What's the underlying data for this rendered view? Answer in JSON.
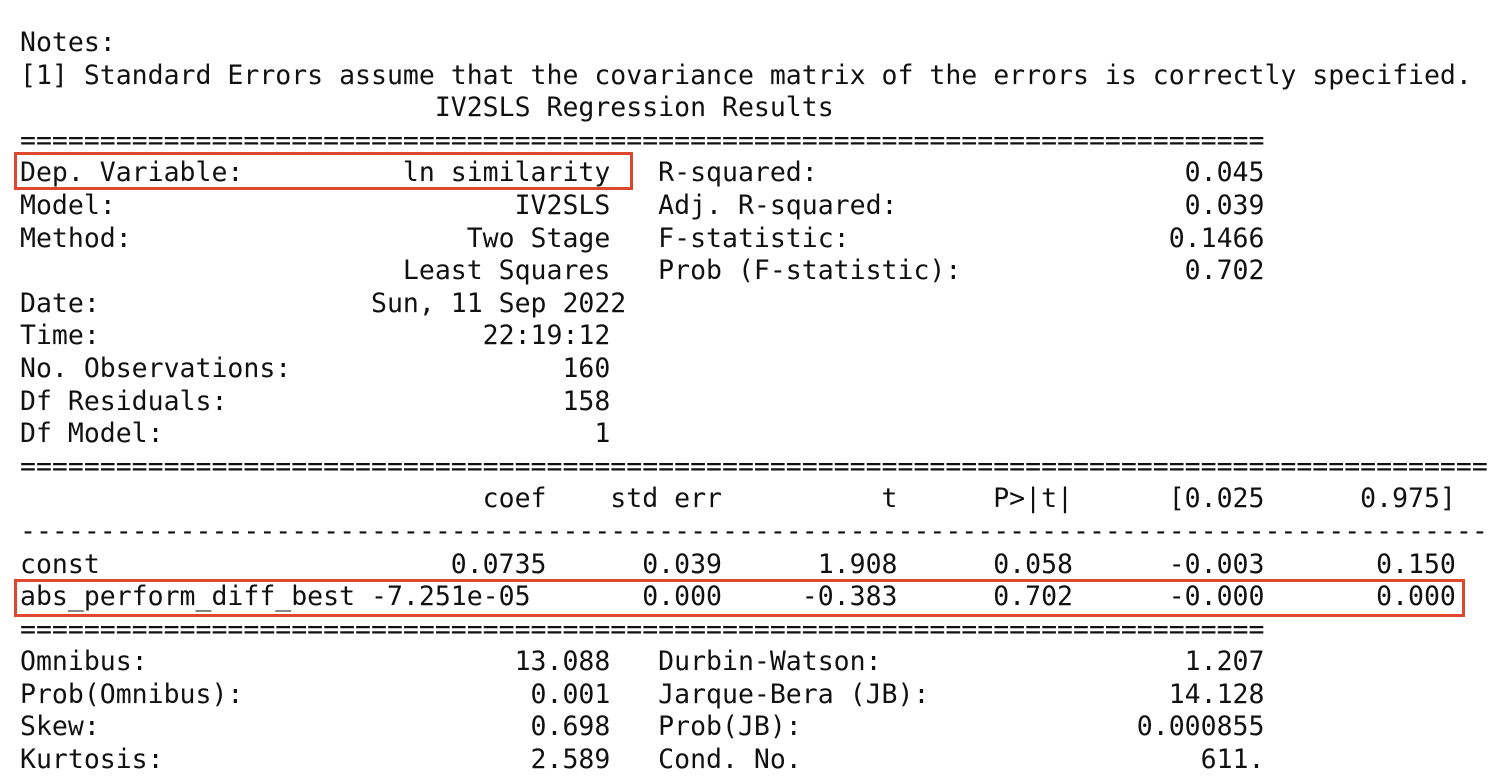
{
  "notes": {
    "header": "Notes:",
    "line1": "[1] Standard Errors assume that the covariance matrix of the errors is correctly specified."
  },
  "title": "IV2SLS Regression Results",
  "separators": {
    "short_double": "==============================================================================",
    "long_double": "============================================================================================",
    "long_dash": "--------------------------------------------------------------------------------------------"
  },
  "top_table": [
    {
      "left_label": "Dep. Variable:",
      "left_value": "ln similarity",
      "right_label": "R-squared:",
      "right_value": "0.045"
    },
    {
      "left_label": "Model:",
      "left_value": "IV2SLS",
      "right_label": "Adj. R-squared:",
      "right_value": "0.039"
    },
    {
      "left_label": "Method:",
      "left_value": "Two Stage",
      "right_label": "F-statistic:",
      "right_value": "0.1466"
    },
    {
      "left_label": "",
      "left_value": "Least Squares",
      "right_label": "Prob (F-statistic):",
      "right_value": "0.702"
    },
    {
      "left_label": "Date:",
      "left_value": "Sun, 11 Sep 2022",
      "right_label": "",
      "right_value": ""
    },
    {
      "left_label": "Time:",
      "left_value": "22:19:12",
      "right_label": "",
      "right_value": ""
    },
    {
      "left_label": "No. Observations:",
      "left_value": "160",
      "right_label": "",
      "right_value": ""
    },
    {
      "left_label": "Df Residuals:",
      "left_value": "158",
      "right_label": "",
      "right_value": ""
    },
    {
      "left_label": "Df Model:",
      "left_value": "1",
      "right_label": "",
      "right_value": ""
    }
  ],
  "coef_table": {
    "headers": [
      "",
      "coef",
      "std err",
      "t",
      "P>|t|",
      "[0.025",
      "0.975]"
    ],
    "rows": [
      [
        "const",
        "0.0735",
        "0.039",
        "1.908",
        "0.058",
        "-0.003",
        "0.150"
      ],
      [
        "abs_perform_diff_best",
        "-7.251e-05",
        "0.000",
        "-0.383",
        "0.702",
        "-0.000",
        "0.000"
      ]
    ]
  },
  "bottom_table": [
    {
      "left_label": "Omnibus:",
      "left_value": "13.088",
      "right_label": "Durbin-Watson:",
      "right_value": "1.207"
    },
    {
      "left_label": "Prob(Omnibus):",
      "left_value": "0.001",
      "right_label": "Jarque-Bera (JB):",
      "right_value": "14.128"
    },
    {
      "left_label": "Skew:",
      "left_value": "0.698",
      "right_label": "Prob(JB):",
      "right_value": "0.000855"
    },
    {
      "left_label": "Kurtosis:",
      "left_value": "2.589",
      "right_label": "Cond. No.",
      "right_value": "611."
    }
  ],
  "highlight_color": "#e0472f"
}
